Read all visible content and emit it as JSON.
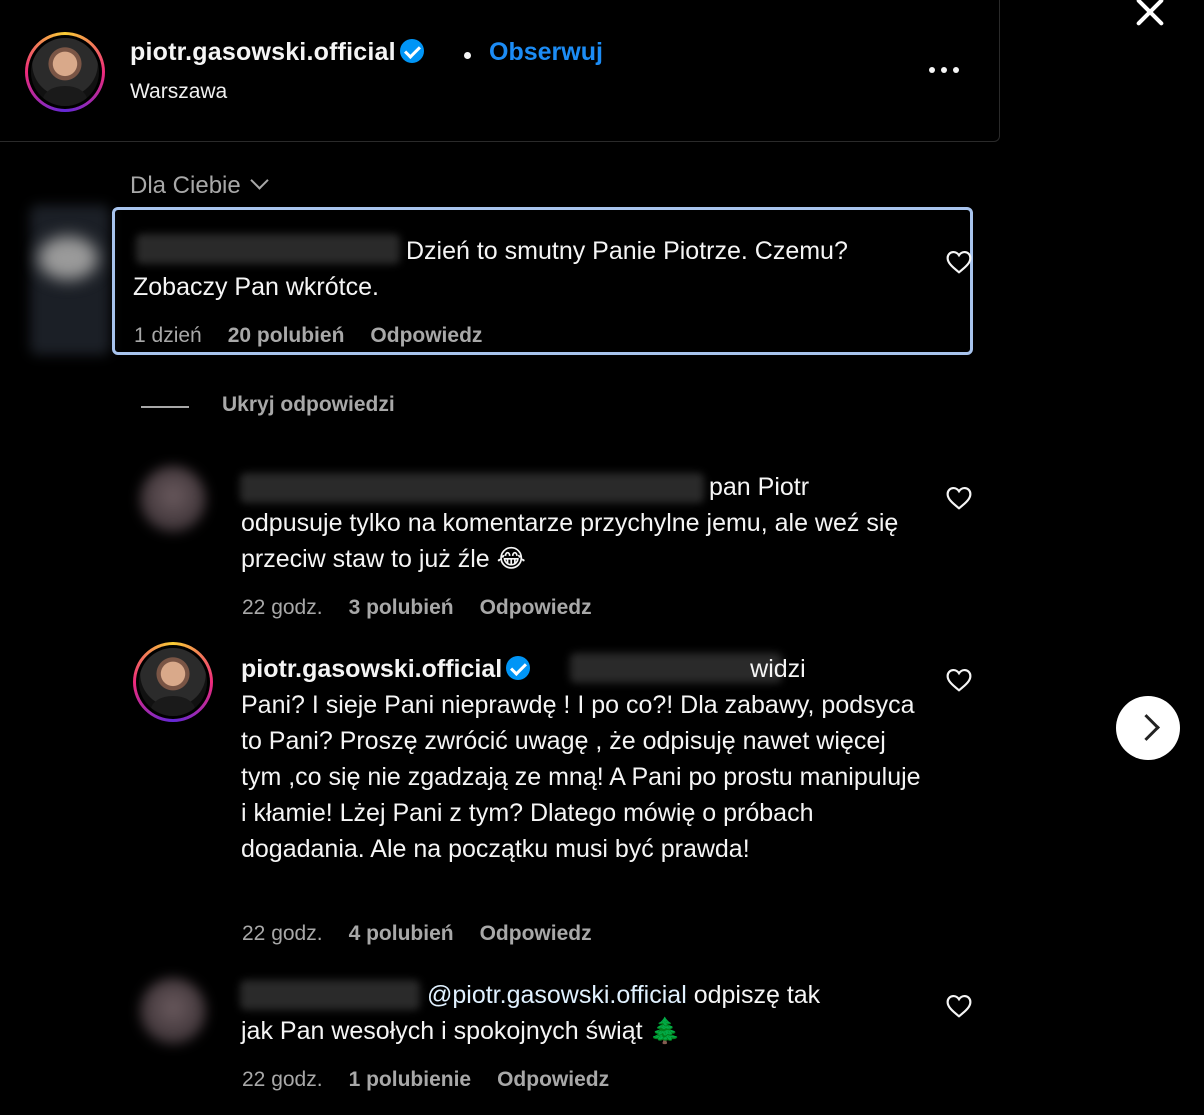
{
  "header": {
    "username": "piotr.gasowski.official",
    "follow_label": "Obserwuj",
    "location": "Warszawa"
  },
  "sort": {
    "label": "Dla Ciebie"
  },
  "comments": [
    {
      "text": "Dzień to smutny Panie Piotrze. Czemu? Zobaczy Pan wkrótce.",
      "time": "1 dzień",
      "likes": "20 polubień",
      "reply": "Odpowiedz"
    }
  ],
  "replies_toggle": "Ukryj odpowiedzi",
  "replies": [
    {
      "text_line1": "pan Piotr",
      "text_rest": "odpusuje tylko na komentarze przychylne jemu, ale weź się przeciw staw to już źle",
      "emoji": "😂",
      "time": "22 godz.",
      "likes": "3 polubień",
      "reply": "Odpowiedz"
    },
    {
      "author": "piotr.gasowski.official",
      "text_line1": "widzi",
      "text_rest": "Pani? I sieje Pani nieprawdę ! I po co?! Dla zabawy, podsyca to Pani? Proszę zwrócić uwagę , że odpisuję nawet więcej tym ,co się nie zgadzają ze mną! A Pani po prostu manipuluje i kłamie! Lżej Pani z tym? Dlatego mówię o próbach dogadania. Ale na początku musi być prawda!",
      "time": "22 godz.",
      "likes": "4 polubień",
      "reply": "Odpowiedz"
    },
    {
      "mention": "@piotr.gasowski.official",
      "text_line1": "odpiszę tak",
      "text_rest": "jak Pan wesołych i spokojnych świąt",
      "emoji": "🌲",
      "time": "22 godz.",
      "likes": "1 polubienie",
      "reply": "Odpowiedz"
    }
  ],
  "colors": {
    "link": "#1c8cf5",
    "verified": "#0095f6",
    "highlight_border": "#a8c4ee",
    "muted": "#a8a8a8"
  }
}
